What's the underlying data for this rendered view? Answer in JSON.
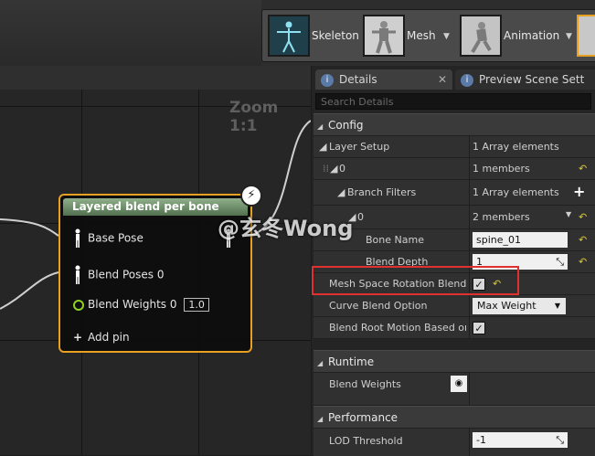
{
  "toolbar": {
    "modes": [
      {
        "label": "Skeleton",
        "icon": "skeleton-thumbnail"
      },
      {
        "label": "Mesh",
        "icon": "mesh-thumbnail"
      },
      {
        "label": "Animation",
        "icon": "animation-thumbnail"
      }
    ]
  },
  "graph": {
    "zoom": "Zoom 1:1",
    "node": {
      "title": "Layered blend per bone",
      "pins": {
        "base_pose": "Base Pose",
        "blend_poses": "Blend Poses 0",
        "blend_weights": "Blend Weights 0",
        "blend_weights_value": "1.0",
        "add_pin": "Add pin"
      }
    }
  },
  "tabs": {
    "details": "Details",
    "preview": "Preview Scene Sett"
  },
  "search": {
    "placeholder": "Search Details"
  },
  "config": {
    "header": "Config",
    "layer_setup": {
      "label": "Layer Setup",
      "value": "1 Array elements"
    },
    "item0": {
      "label": "0",
      "value": "1 members"
    },
    "branch_filters": {
      "label": "Branch Filters",
      "value": "1 Array elements"
    },
    "bf0": {
      "label": "0",
      "value": "2 members"
    },
    "bone_name": {
      "label": "Bone Name",
      "value": "spine_01"
    },
    "blend_depth": {
      "label": "Blend Depth",
      "value": "1"
    },
    "mesh_space_rotation_blend": {
      "label": "Mesh Space Rotation Blend",
      "checked": true
    },
    "curve_blend_option": {
      "label": "Curve Blend Option",
      "value": "Max Weight"
    },
    "blend_root_motion": {
      "label": "Blend Root Motion Based on R",
      "checked": true
    }
  },
  "runtime": {
    "header": "Runtime",
    "blend_weights": {
      "label": "Blend Weights",
      "icon": "eye-icon"
    }
  },
  "performance": {
    "header": "Performance",
    "lod_threshold": {
      "label": "LOD Threshold",
      "value": "-1"
    }
  },
  "watermark": "@玄冬Wong",
  "colors": {
    "node_border": "#e8a020",
    "highlight": "#e03030",
    "reset_arrow": "#d8c63a",
    "exec_pin": "#8dd21e"
  }
}
